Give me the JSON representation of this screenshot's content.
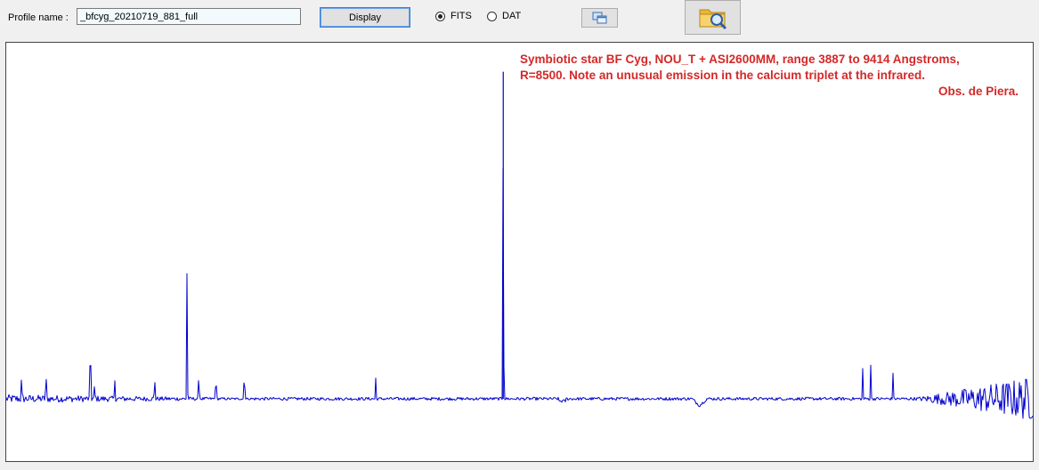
{
  "toolbar": {
    "profile_label": "Profile name :",
    "profile_value": "_bfcyg_20210719_881_full",
    "display_label": "Display",
    "radio_fits_label": "FITS",
    "radio_dat_label": "DAT",
    "selected_format": "FITS"
  },
  "icons": {
    "copy": "copy-windows-icon",
    "open": "folder-search-icon"
  },
  "colors": {
    "spectrum": "#0000cc",
    "annotation": "#d42828"
  },
  "annotation": {
    "line1": "Symbiotic star BF Cyg, NOU_T + ASI2600MM, range 3887 to 9414 Angstroms,",
    "line2": "R=8500. Note an unusual emission in the calcium triplet at the infrared.",
    "line3": "Obs. de Piera."
  },
  "chart_data": {
    "type": "line",
    "title": "",
    "xlabel": "",
    "ylabel": "",
    "xlim": [
      3887,
      9414
    ],
    "ylim": [
      0,
      10
    ],
    "continuum": 1.0,
    "grid": false,
    "legend": "none",
    "series": [
      {
        "values_description_free": true,
        "peaks": [
          {
            "x": 3970,
            "y": 1.8
          },
          {
            "x": 4101,
            "y": 1.9
          },
          {
            "x": 4340,
            "y": 3.2
          },
          {
            "x": 4363,
            "y": 1.5
          },
          {
            "x": 4471,
            "y": 1.6
          },
          {
            "x": 4686,
            "y": 1.7
          },
          {
            "x": 4861,
            "y": 5.3
          },
          {
            "x": 4924,
            "y": 1.8
          },
          {
            "x": 5016,
            "y": 1.8
          },
          {
            "x": 5169,
            "y": 1.9
          },
          {
            "x": 5876,
            "y": 1.6
          },
          {
            "x": 6563,
            "y": 9.7
          },
          {
            "x": 8498,
            "y": 1.9
          },
          {
            "x": 8542,
            "y": 2.0
          },
          {
            "x": 8662,
            "y": 1.8
          }
        ],
        "absorptions": [
          {
            "x": 7605,
            "y": 0.55
          },
          {
            "x": 6870,
            "y": 0.8
          }
        ]
      }
    ]
  }
}
